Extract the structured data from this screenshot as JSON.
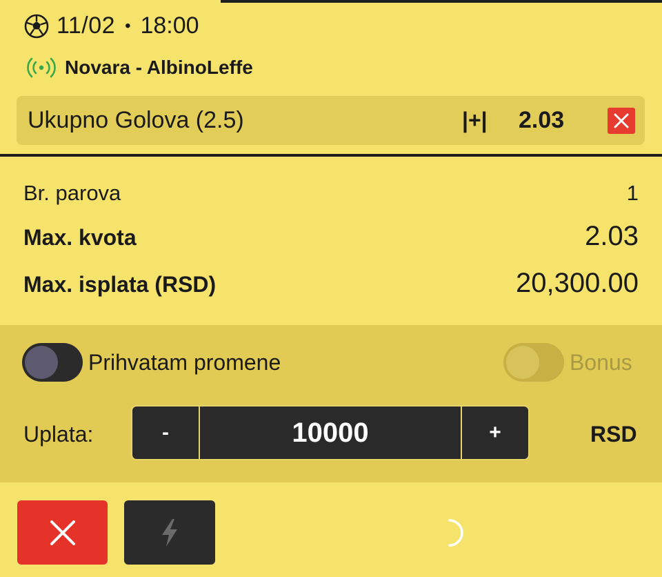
{
  "match": {
    "date": "11/02",
    "separator": "•",
    "time": "18:00",
    "teams": "Novara - AlbinoLeffe"
  },
  "selection": {
    "market": "Ukupno Golova (2.5)",
    "pick": "|+|",
    "odds": "2.03"
  },
  "summary": {
    "pairs_label": "Br. parova",
    "pairs_value": "1",
    "max_odds_label": "Max. kvota",
    "max_odds_value": "2.03",
    "max_payout_label": "Max. isplata (RSD)",
    "max_payout_value": "20,300.00"
  },
  "controls": {
    "accept_changes_label": "Prihvatam promene",
    "bonus_label": "Bonus",
    "stake_label": "Uplata:",
    "minus_label": "-",
    "stake_value": "10000",
    "plus_label": "+",
    "currency": "RSD"
  },
  "icons": {
    "sport": "soccer-ball-icon",
    "live": "live-broadcast-icon",
    "remove": "close-icon",
    "clear": "close-icon",
    "quick_bet": "lightning-icon",
    "loading": "spinner-icon"
  },
  "colors": {
    "background": "#f6e36b",
    "panel": "#e2cb55",
    "danger": "#e63329",
    "dark": "#2b2b2b",
    "live": "#3aa84a"
  }
}
